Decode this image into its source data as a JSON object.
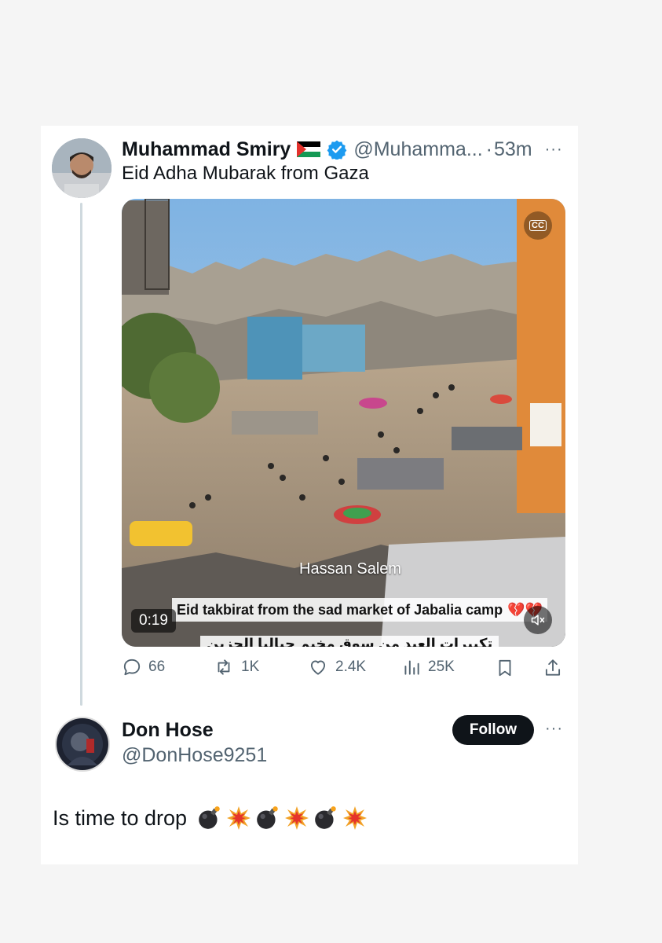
{
  "tweet": {
    "author_name": "Muhammad Smiry",
    "handle": "@Muhamma...",
    "separator": "·",
    "time": "53m",
    "more": "···",
    "text": "Eid Adha Mubarak from Gaza",
    "video": {
      "duration": "0:19",
      "watermark": "Hassan Salem",
      "caption": "Eid takbirat from the sad market of Jabalia camp",
      "caption_emoji": "💔💔",
      "arabic_fragment": "تكبيرات العيد من سوق مخيم جباليا الحزين",
      "cc_label": "CC"
    },
    "actions": {
      "replies": "66",
      "reposts": "1K",
      "likes": "2.4K",
      "views": "25K"
    }
  },
  "reply": {
    "author_name": "Don Hose",
    "handle": "@DonHose9251",
    "follow_label": "Follow",
    "more": "···",
    "text": "Is time to drop"
  },
  "colors": {
    "accent_blue": "#1d9bf0",
    "text_primary": "#0f1419",
    "text_secondary": "#536471",
    "follow_bg": "#0f1419"
  }
}
